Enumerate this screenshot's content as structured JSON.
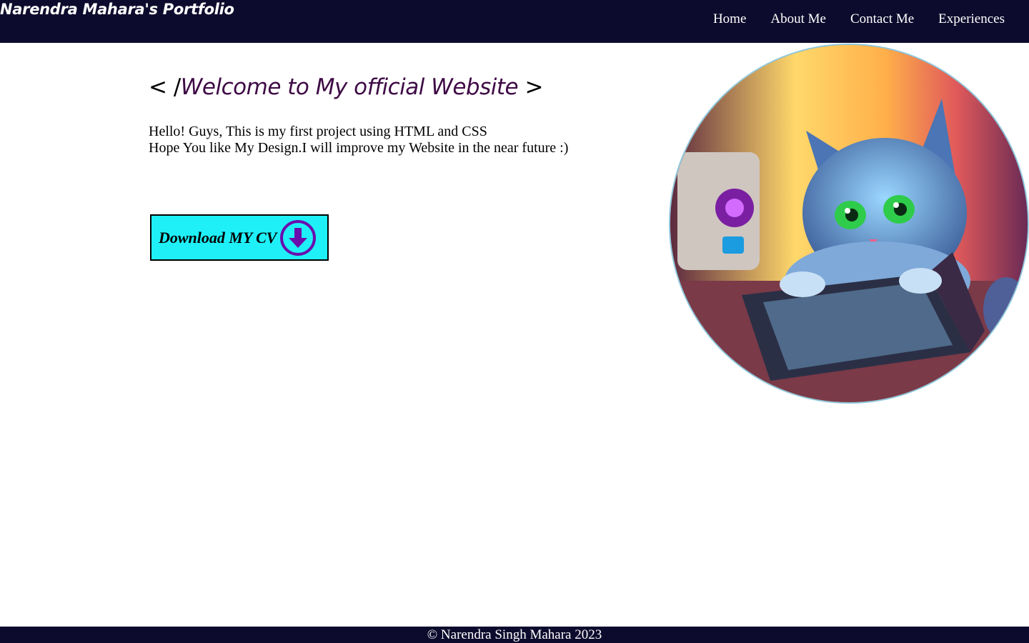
{
  "brand": "Narendra Mahara's Portfolio",
  "nav": [
    {
      "label": "Home"
    },
    {
      "label": "About Me"
    },
    {
      "label": "Contact Me"
    },
    {
      "label": "Experiences"
    }
  ],
  "hero": {
    "bracket_open": "< /",
    "title": "Welcome to My official Website",
    "bracket_close": " >",
    "intro_line1": "Hello! Guys, This is my first project using HTML and CSS",
    "intro_line2": "Hope You like My Design.I will improve my Website in the near future :)"
  },
  "cv_button": {
    "label": "Download MY CV",
    "icon": "download-circle-icon"
  },
  "avatar_image": "cartoon kitten at laptop",
  "footer": "© Narendra Singh Mahara 2023",
  "colors": {
    "navbar_bg": "#0d0b2d",
    "title": "#3e0a45",
    "button_bg": "#1ff0f8",
    "icon": "#6a0dad",
    "avatar_border": "#8ec8de"
  }
}
